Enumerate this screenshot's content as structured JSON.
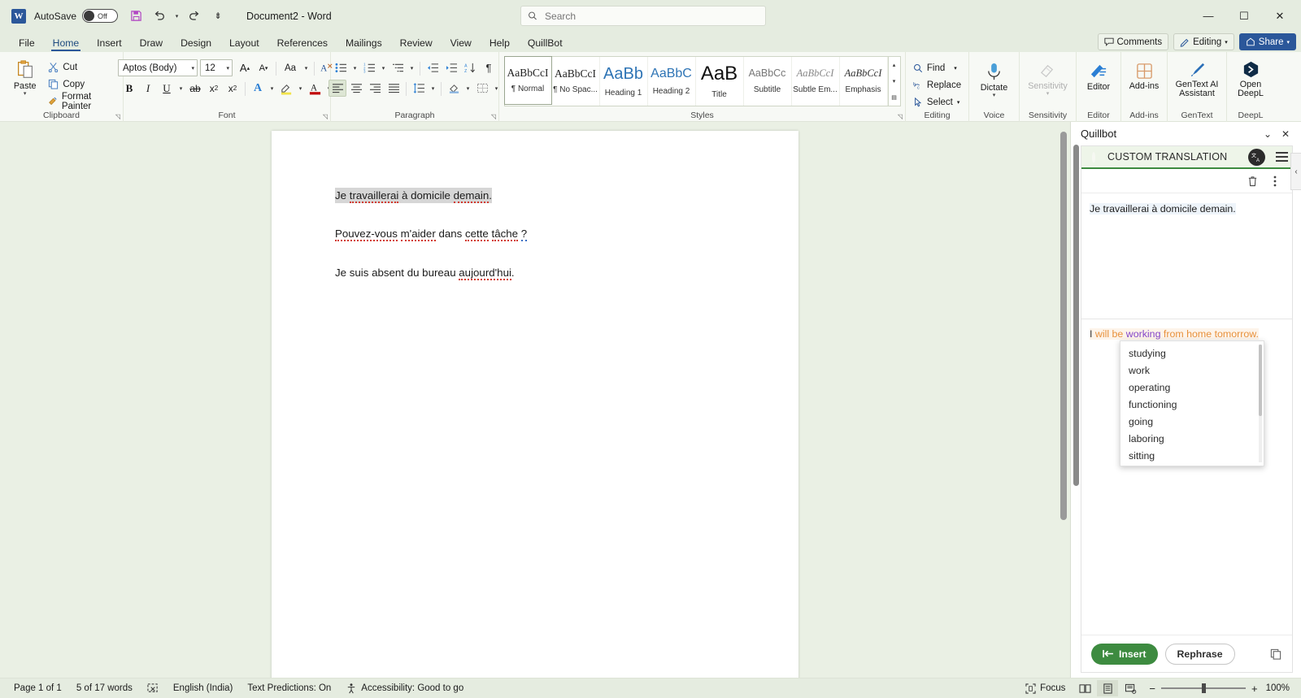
{
  "titlebar": {
    "app_icon": "word-logo",
    "autosave_label": "AutoSave",
    "autosave_state": "Off",
    "save_icon": "save-icon",
    "undo_icon": "undo-icon",
    "redo_icon": "redo-icon",
    "customize_icon": "customize-quick-access-icon",
    "document_title": "Document2  -  Word",
    "minimize": "—",
    "maximize": "☐",
    "close": "✕"
  },
  "search": {
    "placeholder": "Search",
    "value": "",
    "icon": "search-icon"
  },
  "tabs": [
    {
      "label": "File",
      "active": false
    },
    {
      "label": "Home",
      "active": true
    },
    {
      "label": "Insert",
      "active": false
    },
    {
      "label": "Draw",
      "active": false
    },
    {
      "label": "Design",
      "active": false
    },
    {
      "label": "Layout",
      "active": false
    },
    {
      "label": "References",
      "active": false
    },
    {
      "label": "Mailings",
      "active": false
    },
    {
      "label": "Review",
      "active": false
    },
    {
      "label": "View",
      "active": false
    },
    {
      "label": "Help",
      "active": false
    },
    {
      "label": "QuillBot",
      "active": false
    }
  ],
  "tab_trailing": {
    "comments": "Comments",
    "editing": "Editing",
    "share": "Share"
  },
  "ribbon": {
    "clipboard": {
      "group_name": "Clipboard",
      "paste": "Paste",
      "cut": "Cut",
      "copy": "Copy",
      "format_painter": "Format Painter"
    },
    "font": {
      "group_name": "Font",
      "font_family": "Aptos (Body)",
      "font_size": "12",
      "grow_font": "A",
      "shrink_font": "A",
      "change_case": "Aa",
      "clear_formatting": "A",
      "bold": "B",
      "italic": "I",
      "underline": "U",
      "strikethrough": "ab",
      "subscript": "x",
      "superscript": "x",
      "text_effects": "A",
      "highlight": "A",
      "font_color": "A"
    },
    "paragraph": {
      "group_name": "Paragraph",
      "bullets": "bullets-icon",
      "numbering": "numbering-icon",
      "multilevel": "multilevel-list-icon",
      "decrease_indent": "decrease-indent-icon",
      "increase_indent": "increase-indent-icon",
      "sort": "sort-icon",
      "show_marks": "¶",
      "align_left": "align-left-icon",
      "align_center": "align-center-icon",
      "align_right": "align-right-icon",
      "justify": "justify-icon",
      "line_spacing": "line-spacing-icon",
      "shading": "shading-icon",
      "borders": "borders-icon"
    },
    "styles": {
      "group_name": "Styles",
      "items": [
        {
          "preview": "AaBbCcI",
          "name": "¶ Normal",
          "selected": true
        },
        {
          "preview": "AaBbCcI",
          "name": "¶ No Spac...",
          "selected": false
        },
        {
          "preview": "AaBb",
          "name": "Heading 1",
          "selected": false
        },
        {
          "preview": "AaBbC",
          "name": "Heading 2",
          "selected": false
        },
        {
          "preview": "AaB",
          "name": "Title",
          "selected": false
        },
        {
          "preview": "AaBbCc",
          "name": "Subtitle",
          "selected": false
        },
        {
          "preview": "AaBbCcI",
          "name": "Subtle Em...",
          "selected": false
        },
        {
          "preview": "AaBbCcI",
          "name": "Emphasis",
          "selected": false
        }
      ]
    },
    "editing": {
      "group_name": "Editing",
      "find": "Find",
      "replace": "Replace",
      "select": "Select"
    },
    "voice": {
      "group_name": "Voice",
      "dictate": "Dictate"
    },
    "sensitivity": {
      "group_name": "Sensitivity",
      "label": "Sensitivity"
    },
    "editor_group": {
      "group_name": "Editor",
      "label": "Editor"
    },
    "addins": {
      "group_name": "Add-ins",
      "label": "Add-ins"
    },
    "gentext": {
      "group_name": "GenText",
      "label": "GenText AI Assistant"
    },
    "deepl": {
      "group_name": "DeepL",
      "label": "Open DeepL"
    }
  },
  "document": {
    "paragraphs": [
      {
        "selected": true,
        "runs": [
          {
            "t": "Je ",
            "u": "none"
          },
          {
            "t": "travaillerai",
            "u": "red"
          },
          {
            "t": " à domicile ",
            "u": "none"
          },
          {
            "t": "demain",
            "u": "red"
          },
          {
            "t": ".",
            "u": "none"
          }
        ]
      },
      {
        "selected": false,
        "runs": [
          {
            "t": "Pouvez-vous",
            "u": "red"
          },
          {
            "t": " ",
            "u": "none"
          },
          {
            "t": "m'aider",
            "u": "red"
          },
          {
            "t": " dans ",
            "u": "none"
          },
          {
            "t": "cette",
            "u": "red"
          },
          {
            "t": " ",
            "u": "none"
          },
          {
            "t": "tâche",
            "u": "red"
          },
          {
            "t": " ",
            "u": "none"
          },
          {
            "t": "?",
            "u": "blue"
          }
        ]
      },
      {
        "selected": false,
        "runs": [
          {
            "t": "Je suis absent du bureau ",
            "u": "none"
          },
          {
            "t": "aujourd'hui",
            "u": "red"
          },
          {
            "t": ".",
            "u": "none"
          }
        ]
      }
    ]
  },
  "panel": {
    "title": "Quillbot",
    "collapse_icon": "chevron-down-icon",
    "close_icon": "close-icon",
    "collapse_handle": "chevron-left-icon",
    "brand": "CUSTOM TRANSLATION",
    "translate_icon": "translate-icon",
    "menu_icon": "hamburger-menu-icon",
    "delete_icon": "trash-icon",
    "more_icon": "more-vertical-icon",
    "source_text": "Je travaillerai à domicile demain.",
    "output_runs": [
      {
        "t": "I ",
        "c": "plain"
      },
      {
        "t": "will be ",
        "c": "orange"
      },
      {
        "t": "working",
        "c": "purple"
      },
      {
        "t": " from home tomorrow.",
        "c": "orange"
      }
    ],
    "synonyms": [
      "studying",
      "work",
      "operating",
      "functioning",
      "going",
      "laboring",
      "sitting"
    ],
    "insert_button": "Insert",
    "rephrase_button": "Rephrase",
    "copy_icon": "copy-icon",
    "accent_green": "#3d8b40",
    "highlight_purple": "#8445c8",
    "highlight_orange": "#e8913c"
  },
  "statusbar": {
    "page": "Page 1 of 1",
    "words": "5 of 17 words",
    "proofing_icon": "proofing-errors-icon",
    "language": "English (India)",
    "predictions": "Text Predictions: On",
    "accessibility": "Accessibility: Good to go",
    "focus": "Focus",
    "view_read": "read-mode-icon",
    "view_print": "print-layout-icon",
    "view_web": "web-layout-icon",
    "zoom_out": "−",
    "zoom_in": "+",
    "zoom_level": "100%"
  }
}
